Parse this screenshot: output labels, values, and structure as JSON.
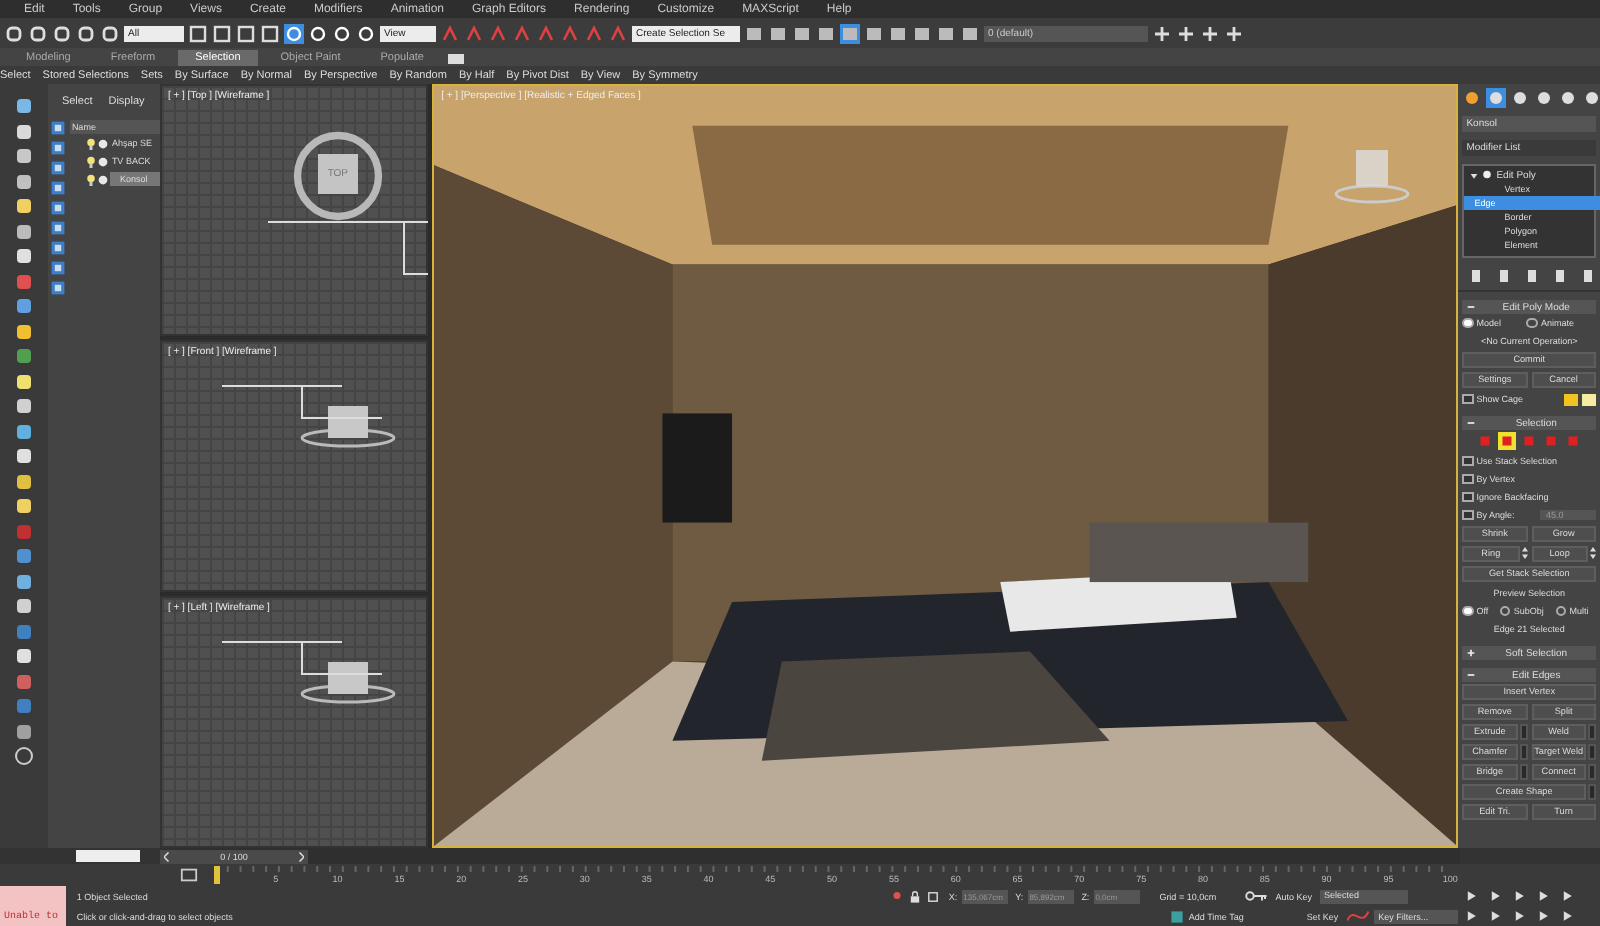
{
  "menu_bar": {
    "items": [
      "Edit",
      "Tools",
      "Group",
      "Views",
      "Create",
      "Modifiers",
      "Animation",
      "Graph Editors",
      "Rendering",
      "Customize",
      "MAXScript",
      "Help"
    ]
  },
  "toolbar": {
    "selection_filter": "All",
    "reference_coord": "View",
    "named_selection": "Create Selection Se",
    "layer": "0 (default)"
  },
  "ribbon": {
    "tabs": [
      {
        "label": "Modeling",
        "selected": false
      },
      {
        "label": "Freeform",
        "selected": false
      },
      {
        "label": "Selection",
        "selected": true
      },
      {
        "label": "Object Paint",
        "selected": false
      },
      {
        "label": "Populate",
        "selected": false
      }
    ],
    "tools": [
      "Select",
      "Stored Selections",
      "Sets",
      "By Surface",
      "By Normal",
      "By Perspective",
      "By Random",
      "By Half",
      "By Pivot Dist",
      "By View",
      "By Symmetry"
    ]
  },
  "scene_explorer": {
    "tabs": [
      "Select",
      "Display"
    ],
    "column": "Name",
    "items": [
      {
        "name": "Ahşap SE",
        "selected": false
      },
      {
        "name": "TV BACK",
        "selected": false
      },
      {
        "name": "Konsol",
        "selected": true
      }
    ]
  },
  "viewports": [
    {
      "label": "[ + ] [Top ] [Wireframe ]",
      "viewcube": "TOP"
    },
    {
      "label": "[ + ] [Front ] [Wireframe ]"
    },
    {
      "label": "[ + ] [Left ] [Wireframe ]"
    }
  ],
  "perspective": {
    "label": "[ + ] [Perspective ] [Realistic + Edged Faces ]"
  },
  "command_panel": {
    "object_name": "Konsol",
    "modifier_list": "Modifier List",
    "stack": [
      {
        "name": "Edit Poly",
        "expanded": true,
        "children": [
          {
            "name": "Vertex",
            "selected": false
          },
          {
            "name": "Edge",
            "selected": true
          },
          {
            "name": "Border",
            "selected": false
          },
          {
            "name": "Polygon",
            "selected": false
          },
          {
            "name": "Element",
            "selected": false
          }
        ]
      }
    ],
    "rollouts": [
      {
        "title": "Edit Poly Mode",
        "expanded": true,
        "rows": [
          [
            {
              "kind": "radio",
              "label": "Model",
              "selected": true
            },
            {
              "kind": "radio",
              "label": "Animate",
              "selected": false
            }
          ],
          [
            {
              "kind": "text",
              "label": "<No Current Operation>"
            }
          ],
          [
            {
              "kind": "button",
              "label": "Commit"
            }
          ],
          [
            {
              "kind": "button",
              "label": "Settings"
            },
            {
              "kind": "button",
              "label": "Cancel"
            }
          ],
          [
            {
              "kind": "checkbox",
              "label": "Show Cage",
              "checked": false
            },
            {
              "kind": "swatch",
              "color": "#f2c21e"
            },
            {
              "kind": "swatch",
              "color": "#f5eba2"
            }
          ]
        ]
      },
      {
        "title": "Selection",
        "expanded": true,
        "rows": [
          [
            {
              "kind": "icon",
              "selected": false
            },
            {
              "kind": "icon",
              "selected": true
            },
            {
              "kind": "icon",
              "selected": false
            },
            {
              "kind": "icon",
              "selected": false
            },
            {
              "kind": "icon",
              "selected": false
            }
          ],
          [
            {
              "kind": "checkbox",
              "label": "Use Stack Selection",
              "checked": false
            }
          ],
          [
            {
              "kind": "checkbox",
              "label": "By Vertex",
              "checked": false
            }
          ],
          [
            {
              "kind": "checkbox",
              "label": "Ignore Backfacing",
              "checked": false
            }
          ],
          [
            {
              "kind": "checkbox",
              "label": "By Angle:",
              "checked": false
            },
            {
              "kind": "field",
              "label": "45.0"
            }
          ],
          [
            {
              "kind": "button",
              "label": "Shrink"
            },
            {
              "kind": "button",
              "label": "Grow"
            }
          ],
          [
            {
              "kind": "spinbutton",
              "label": "Ring"
            },
            {
              "kind": "spinbutton",
              "label": "Loop"
            }
          ],
          [
            {
              "kind": "button",
              "label": "Get Stack Selection"
            }
          ],
          [
            {
              "kind": "text",
              "label": "Preview Selection"
            }
          ],
          [
            {
              "kind": "radio",
              "label": "Off",
              "selected": true
            },
            {
              "kind": "radio",
              "label": "SubObj",
              "selected": false
            },
            {
              "kind": "radio",
              "label": "Multi",
              "selected": false
            }
          ],
          [
            {
              "kind": "text",
              "label": "Edge 21 Selected"
            }
          ]
        ]
      },
      {
        "title": "Soft Selection",
        "expanded": false
      },
      {
        "title": "Edit Edges",
        "expanded": true,
        "rows": [
          [
            {
              "kind": "button",
              "label": "Insert Vertex"
            }
          ],
          [
            {
              "kind": "button",
              "label": "Remove"
            },
            {
              "kind": "button",
              "label": "Split"
            }
          ],
          [
            {
              "kind": "button",
              "label": "Extrude",
              "settings": true
            },
            {
              "kind": "button",
              "label": "Weld",
              "settings": true
            }
          ],
          [
            {
              "kind": "button",
              "label": "Chamfer",
              "settings": true
            },
            {
              "kind": "button",
              "label": "Target Weld",
              "settings": true
            }
          ],
          [
            {
              "kind": "button",
              "label": "Bridge",
              "settings": true
            },
            {
              "kind": "button",
              "label": "Connect",
              "settings": true
            }
          ],
          [
            {
              "kind": "button",
              "label": "Create Shape",
              "settings": true
            }
          ],
          [
            {
              "kind": "button",
              "label": "Edit Tri."
            },
            {
              "kind": "button",
              "label": "Turn"
            }
          ]
        ]
      }
    ]
  },
  "time_slider": {
    "position": "0 / 100",
    "level": 0,
    "ticks": [
      "5",
      "10",
      "15",
      "20",
      "25",
      "30",
      "35",
      "40",
      "45",
      "50",
      "55",
      "60",
      "65",
      "70",
      "75",
      "80",
      "85",
      "90",
      "95",
      "100"
    ]
  },
  "status_bar": {
    "listener_output": "Unable to",
    "selection": "1 Object Selected",
    "prompt": "Click or click-and-drag to select objects",
    "x_label": "X:",
    "x": "135,067cm",
    "y_label": "Y:",
    "y": "85,892cm",
    "z_label": "Z:",
    "z": "0,0cm",
    "grid": "Grid = 10,0cm",
    "add_time_tag": "Add Time Tag",
    "auto_key": "Auto Key",
    "key_mode": "Selected",
    "set_key": "Set Key",
    "key_filters": "Key Filters..."
  }
}
